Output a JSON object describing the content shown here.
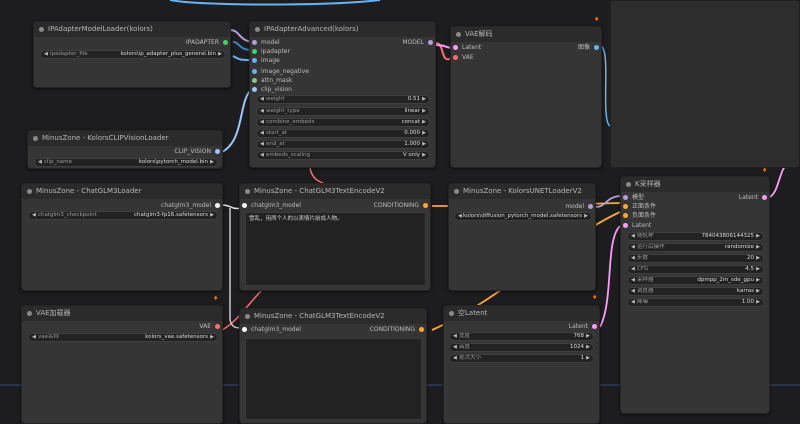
{
  "nodes": {
    "ipadapter_loader": {
      "title": "IPAdapterModelLoader(kolors)",
      "output": "IPADAPTER",
      "widget_label": "ipadapter_file",
      "widget_value": "kolors\\ip_adapter_plus_general.bin"
    },
    "clip_vision_loader": {
      "title": "MinusZone - KolorsCLIPVisionLoader",
      "output": "CLIP_VISION",
      "widget_label": "clip_name",
      "widget_value": "kolors\\pytorch_model.bin"
    },
    "ipadapter_advanced": {
      "title": "IPAdapterAdvanced(kolors)",
      "inputs": [
        "model",
        "ipadapter",
        "image",
        "image_negative",
        "attn_mask",
        "clip_vision"
      ],
      "output": "MODEL",
      "widgets": [
        {
          "label": "weight",
          "value": "0.51"
        },
        {
          "label": "weight_type",
          "value": "linear"
        },
        {
          "label": "combine_embeds",
          "value": "concat"
        },
        {
          "label": "start_at",
          "value": "0.000"
        },
        {
          "label": "end_at",
          "value": "1.000"
        },
        {
          "label": "embeds_scaling",
          "value": "V only"
        }
      ]
    },
    "vae_decode": {
      "title": "VAE解码",
      "inputs": [
        "Latent",
        "VAE"
      ],
      "output": "图像"
    },
    "chatglm_loader": {
      "title": "MinusZone - ChatGLM3Loader",
      "output": "chatglm3_model",
      "widget_label": "chatglm3_checkpoint",
      "widget_value": "chatglm3-fp16.safetensors"
    },
    "text_encode_pos": {
      "title": "MinusZone - ChatGLM3TextEncodeV2",
      "input": "chatglm3_model",
      "output": "CONDITIONING",
      "text": "雪乱，用两个人的以表情片前成人物。"
    },
    "unet_loader": {
      "title": "MinusZone - KolorsUNETLoaderV2",
      "output": "model",
      "widget_value": "kolors\\diffusion_pytorch_model.safetensors"
    },
    "ksampler": {
      "title": "K采样器",
      "inputs": [
        "模型",
        "正面条件",
        "负面条件",
        "Latent"
      ],
      "output": "Latent",
      "widgets": [
        {
          "label": "随机种",
          "value": "784043806144325"
        },
        {
          "label": "运行后操作",
          "value": "randomize"
        },
        {
          "label": "步数",
          "value": "20"
        },
        {
          "label": "CFG",
          "value": "4.5"
        },
        {
          "label": "采样器",
          "value": "dpmpp_2m_sde_gpu"
        },
        {
          "label": "调度器",
          "value": "karras"
        },
        {
          "label": "降噪",
          "value": "1.00"
        }
      ]
    },
    "vae_loader": {
      "title": "VAE加载器",
      "output": "VAE",
      "widget_label": "vae名称",
      "widget_value": "kolors_vae.safetensors"
    },
    "text_encode_neg": {
      "title": "MinusZone - ChatGLM3TextEncodeV2",
      "input": "chatglm3_model",
      "output": "CONDITIONING",
      "text": ""
    },
    "empty_latent": {
      "title": "空Latent",
      "output": "Latent",
      "widgets": [
        {
          "label": "宽度",
          "value": "768"
        },
        {
          "label": "高度",
          "value": "1024"
        },
        {
          "label": "批次大小",
          "value": "1"
        }
      ]
    }
  },
  "colors": {
    "model": "#b39ddb",
    "clip": "#ffd500",
    "ipadapter": "#3b82c4",
    "image": "#64b5f6",
    "conditioning": "#ffa931",
    "latent": "#ff9cf9",
    "vae": "#ff6e6e",
    "chatglm": "#ffffff",
    "clip_vision": "#a1c4fd",
    "ipadapter_out": "#3fd36b"
  }
}
